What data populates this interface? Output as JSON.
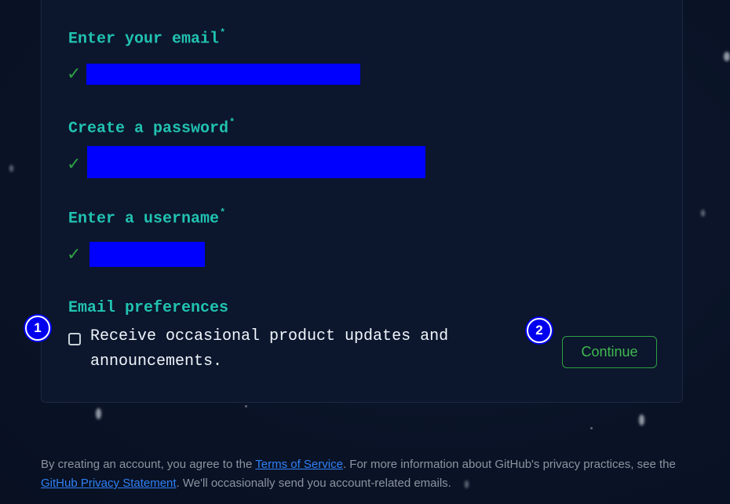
{
  "form": {
    "email": {
      "label": "Enter your email",
      "required_mark": "*",
      "check_icon": "✓"
    },
    "password": {
      "label": "Create a password",
      "required_mark": "*",
      "check_icon": "✓"
    },
    "username": {
      "label": "Enter a username",
      "required_mark": "*",
      "check_icon": "✓"
    },
    "preferences": {
      "label": "Email preferences",
      "checkbox_label": "Receive occasional product updates and announcements.",
      "checked": false
    },
    "continue_label": "Continue"
  },
  "markers": [
    "1",
    "2"
  ],
  "footer": {
    "text_1": "By creating an account, you agree to the ",
    "terms_link": "Terms of Service",
    "text_2": ". For more information about GitHub's privacy practices, see the ",
    "privacy_link": "GitHub Privacy Statement",
    "text_3": ". We'll occasionally send you account-related emails."
  },
  "colors": {
    "label": "#21c3b1",
    "check": "#2ea043",
    "continue": "#3fb950",
    "link": "#2f81f7",
    "redaction": "#0000ff",
    "marker": "#0000ee"
  }
}
